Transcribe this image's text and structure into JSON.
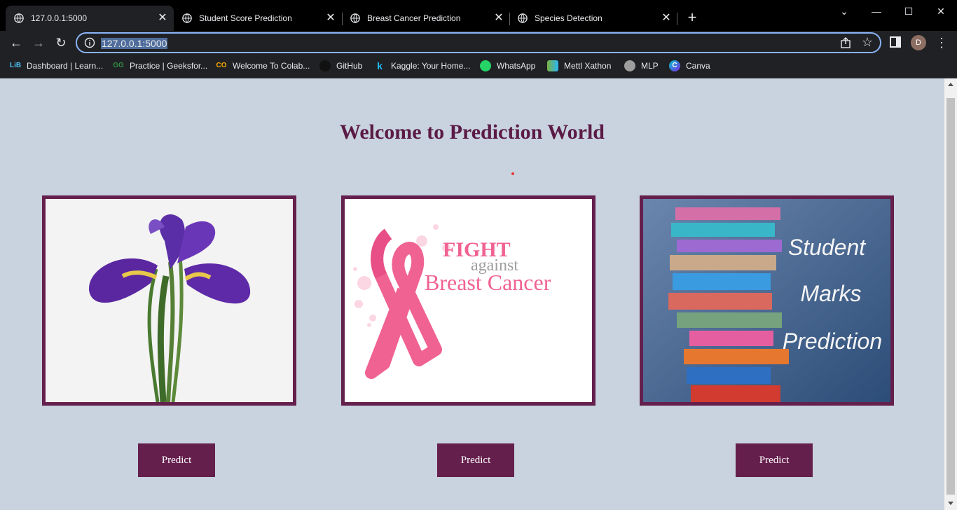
{
  "browser": {
    "tabs": [
      {
        "title": "127.0.0.1:5000",
        "active": true
      },
      {
        "title": "Student Score Prediction",
        "active": false
      },
      {
        "title": "Breast Cancer Prediction",
        "active": false
      },
      {
        "title": "Species Detection",
        "active": false
      }
    ],
    "new_tab_symbol": "+",
    "url": "127.0.0.1:5000",
    "profile_initial": "D",
    "bookmarks": [
      {
        "label": "Dashboard | Learn...",
        "icon": "LiB"
      },
      {
        "label": "Practice | Geeksfor...",
        "icon": "GG"
      },
      {
        "label": "Welcome To Colab...",
        "icon": "CO"
      },
      {
        "label": "GitHub",
        "icon": "github"
      },
      {
        "label": "Kaggle: Your Home...",
        "icon": "k"
      },
      {
        "label": "WhatsApp",
        "icon": "whatsapp"
      },
      {
        "label": "Mettl Xathon",
        "icon": "mettl"
      },
      {
        "label": "MLP",
        "icon": "mlp"
      },
      {
        "label": "Canva",
        "icon": "C"
      }
    ]
  },
  "page": {
    "heading": "Welcome to Prediction World",
    "cards": [
      {
        "name": "iris",
        "button_label": "Predict"
      },
      {
        "name": "breast-cancer",
        "button_label": "Predict",
        "image_text": {
          "line1": "FIGHT",
          "line2": "against",
          "line3": "Breast Cancer"
        }
      },
      {
        "name": "student-marks",
        "button_label": "Predict",
        "image_text": {
          "line1": "Student",
          "line2": "Marks",
          "line3": "Prediction"
        }
      }
    ]
  },
  "colors": {
    "background": "#c8d3df",
    "accent": "#651f4d",
    "heading": "#5b1a45"
  }
}
